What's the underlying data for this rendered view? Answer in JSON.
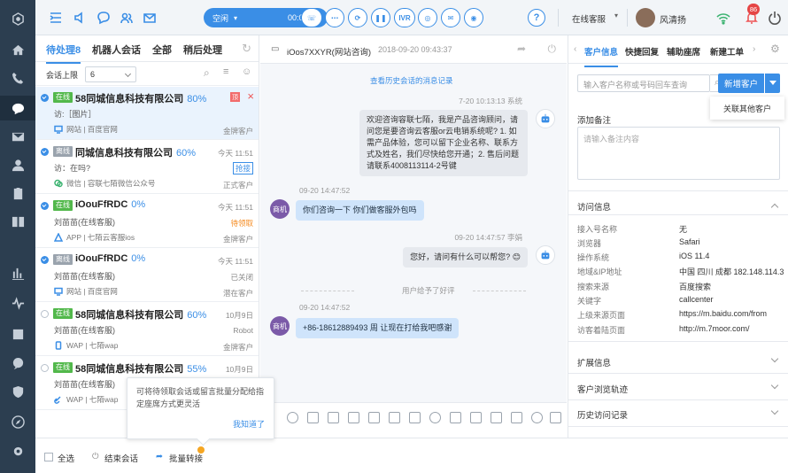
{
  "topbar": {
    "status_label": "空闲",
    "status_timer": "00:02:02",
    "ivr_label": "IVR",
    "online_status": "在线客服",
    "user_name": "风清扬",
    "notification_count": "86"
  },
  "list": {
    "tabs": [
      "待处理8",
      "机器人会话",
      "全部",
      "稍后处理"
    ],
    "limit_label": "会话上限",
    "limit_value": "6",
    "items": [
      {
        "badge": "在线",
        "name": "58同城信息科技有限公司",
        "pct": "80%",
        "sub": "访:［图片］",
        "src": "网站 | 百度官网",
        "time": "",
        "status": "",
        "level": "金牌客户"
      },
      {
        "badge": "离线",
        "name": "同城信息科技有限公司",
        "pct": "60%",
        "sub": "访：在吗?",
        "src": "微信 | 容联七陌微信公众号",
        "time": "今天 11:51",
        "status": "抢接",
        "level": "正式客户"
      },
      {
        "badge": "在线",
        "name": "iOouFfRDC",
        "pct": "0%",
        "sub": "刘苗苗(在线客服)",
        "src": "APP | 七陌云客服ios",
        "time": "今天 11:51",
        "status": "待领取",
        "level": "金牌客户"
      },
      {
        "badge": "离线",
        "name": "iOouFfRDC",
        "pct": "0%",
        "sub": "刘苗苗(在线客服)",
        "src": "网站 | 百度官网",
        "time": "今天 11:51",
        "status": "已关闭",
        "level": "潜在客户"
      },
      {
        "badge": "在线",
        "name": "58同城信息科技有限公司",
        "pct": "60%",
        "sub": "刘苗苗(在线客服)",
        "src": "WAP | 七陌wap",
        "time": "10月9日",
        "status": "Robot",
        "level": "金牌客户"
      },
      {
        "badge": "在线",
        "name": "58同城信息科技有限公司",
        "pct": "55%",
        "sub": "刘苗苗(在线客服)",
        "src": "WAP | 七陌wap",
        "time": "10月9日",
        "status": "",
        "level": ""
      }
    ],
    "top_tag": "顶"
  },
  "tooltip": {
    "text": "可将待领取会话或留言批量分配给指定座席方式更灵活",
    "ok": "我知道了"
  },
  "footer": {
    "select_all": "全选",
    "end_session": "结束会话",
    "batch_transfer": "批量转接"
  },
  "chat": {
    "title": "iOos7XXYR(网站咨询)",
    "datetime": "2018-09-20 09:43:37",
    "history_link": "查看历史会话的消息记录",
    "msgs": {
      "t1": "7-20  10:13:13  系统",
      "b1": "欢迎咨询容联七陌，我是产品咨询顾问，请问您是要咨询云客服or云电销系统呢? 1. 如需产品体验，您可以留下企业名称、联系方式及姓名，我们尽快给您开通；2. 售后问题请联系4008113114-2号键",
      "t2": "09-20 14:47:52",
      "b2": "你们咨询一下 你们做客服外包吗",
      "t3": "09-20 14:47:57  李娟",
      "b3": "您好，请问有什么可以帮您? 😊",
      "sys": "用户给予了好评",
      "t4": "09-20 14:47:52",
      "b4": "+86-18612889493 周 让现在打给我吧感谢",
      "cust_avatar": "商机"
    }
  },
  "right": {
    "tabs": [
      "客户信息",
      "快捷回复",
      "辅助座席",
      "新建工单"
    ],
    "search_placeholder": "输入客户名称或号码回车查询",
    "new_customer": "新增客户",
    "link_other": "关联其他客户",
    "note_title": "添加备注",
    "note_placeholder": "请输入备注内容",
    "visit_title": "访问信息",
    "visit": [
      {
        "k": "接入号名称",
        "v": "无"
      },
      {
        "k": "浏览器",
        "v": "Safari"
      },
      {
        "k": "操作系统",
        "v": "iOS 11.4"
      },
      {
        "k": "地域&IP地址",
        "v": "中国 四川 成都 182.148.114.3"
      },
      {
        "k": "搜索来源",
        "v": "百度搜索"
      },
      {
        "k": "关键字",
        "v": "callcenter"
      },
      {
        "k": "上级来源页面",
        "v": "https://m.baidu.com/from"
      },
      {
        "k": "访客着陆页面",
        "v": "http://m.7moor.com/"
      }
    ],
    "sections": [
      "扩展信息",
      "客户浏览轨迹",
      "历史访问记录"
    ]
  }
}
